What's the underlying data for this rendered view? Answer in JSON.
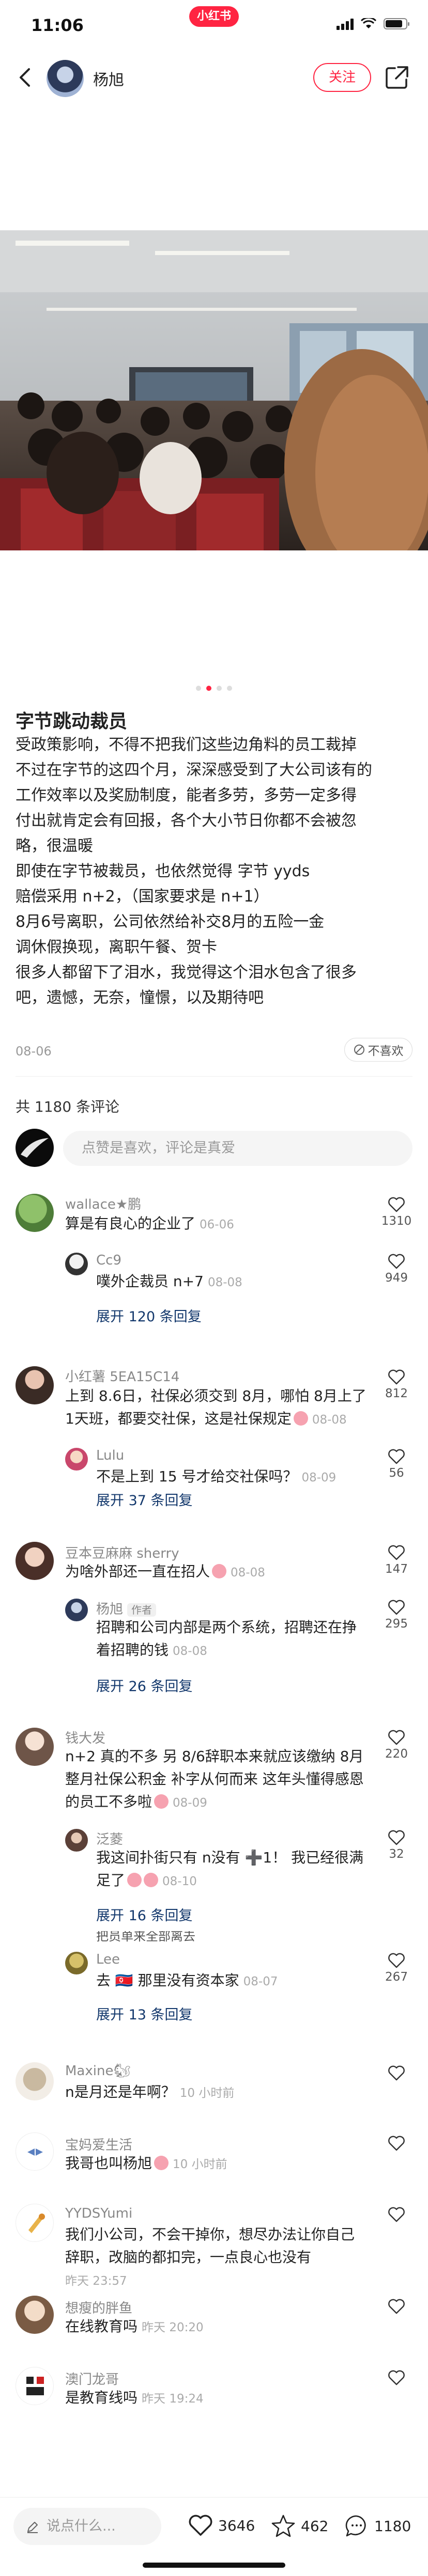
{
  "status_bar": {
    "time": "11:06",
    "app_pill": "小红书"
  },
  "header": {
    "author_name": "杨旭",
    "follow_label": "关注"
  },
  "post": {
    "image_count": 4,
    "active_image_index": 1,
    "title": "字节跳动裁员",
    "body": [
      "受政策影响，不得不把我们这些边角料的员工裁掉",
      "不过在字节的这四个月，深深感受到了大公司该有的",
      "工作效率以及奖励制度，能者多劳，多劳一定多得",
      "付出就肯定会有回报，各个大小节日你都不会被忽",
      "略，很温暖",
      "即使在字节被裁员，也依然觉得 字节 yyds",
      "赔偿采用 n+2，（国家要求是 n+1）",
      "8月6号离职，公司依然给补交8月的五险一金",
      "调休假换现，离职午餐、贺卡",
      "很多人都留下了泪水，我觉得这个泪水包含了很多",
      "吧，遗憾，无奈，憧憬，以及期待吧"
    ],
    "date": "08-06",
    "dislike_label": "不喜欢"
  },
  "comments_section": {
    "count_label": "共 1180 条评论",
    "input_placeholder": "点赞是喜欢，评论是真爱"
  },
  "comments": [
    {
      "name": "wallace★鹏",
      "text": "算是有良心的企业了",
      "date": "06-06",
      "likes": "1310",
      "reply": {
        "name": "Cc9",
        "text": "噗外企裁员 n+7",
        "date": "08-08",
        "likes": "949"
      },
      "expand": "展开 120 条回复"
    },
    {
      "name": "小红薯 5EA15C14",
      "text1": "上到 8.6日，社保必须交到 8月，哪怕 8月上了",
      "text2": "1天班，都要交社保，这是社保规定",
      "date": "08-08",
      "likes": "812",
      "reply": {
        "name": "Lulu",
        "text": "不是上到 15 号才给交社保吗？",
        "date": "08-09",
        "likes": "56"
      },
      "expand": "展开 37 条回复"
    },
    {
      "name": "豆本豆麻麻 sherry",
      "text": "为啥外部还一直在招人",
      "date": "08-08",
      "likes": "147",
      "reply": {
        "name": "杨旭",
        "author_tag": "作者",
        "text1": "招聘和公司内部是两个系统，招聘还在挣",
        "text2": "着招聘的钱",
        "date": "08-08",
        "likes": "295"
      },
      "expand": "展开 26 条回复"
    },
    {
      "name": "钱大发",
      "text1": "n+2 真的不多 另 8/6辞职本来就应该缴纳 8月",
      "text2": "整月社保公积金 补字从何而来 这年头懂得感恩",
      "text3": "的员工不多啦",
      "date": "08-09",
      "likes": "220",
      "reply": {
        "name": "泛菱",
        "text1": "我这间扑街只有 n没有 ➕1！ 我已经很满",
        "text2": "足了",
        "date": "08-10",
        "likes": "32"
      },
      "expand": "展开 16 条回复"
    },
    {
      "partial_text": "把员单来全部离去",
      "reply": {
        "name": "Lee",
        "text": "去 🇰🇵 那里没有资本家",
        "date": "08-07",
        "likes": "267"
      },
      "expand": "展开 13 条回复"
    },
    {
      "name": "Maxine🐿",
      "text": "n是月还是年啊？",
      "date": "10 小时前"
    },
    {
      "name": "宝妈爱生活",
      "text": "我哥也叫杨旭",
      "date": "10 小时前"
    },
    {
      "name": "YYDSYumi",
      "text1": "我们小公司，不会干掉你，想尽办法让你自己",
      "text2": "辞职，改脑的都扣完，一点良心也没有",
      "date": "昨天 23:57"
    },
    {
      "name": "想瘦的胖鱼",
      "text": "在线教育吗",
      "date": "昨天 20:20"
    },
    {
      "name": "澳门龙哥",
      "text": "是教育线吗",
      "date": "昨天 19:24"
    }
  ],
  "bottom_bar": {
    "input_placeholder": "说点什么...",
    "likes": "3646",
    "collects": "462",
    "comments": "1180"
  }
}
